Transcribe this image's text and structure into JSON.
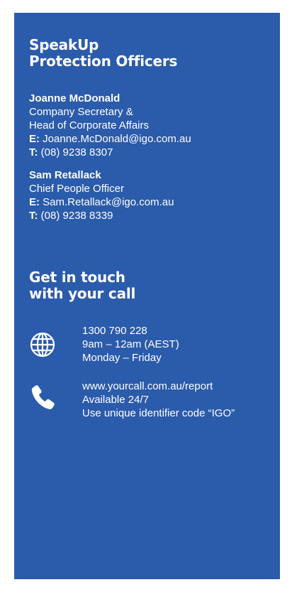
{
  "officers_section": {
    "heading_line1": "SpeakUp",
    "heading_line2": "Protection Officers",
    "officers": [
      {
        "name": "Joanne McDonald",
        "title_line1": "Company Secretary &",
        "title_line2": "Head of Corporate Affairs",
        "email_label": "E:",
        "email": "Joanne.McDonald@igo.com.au",
        "phone_label": "T:",
        "phone": "(08) 9238 8307"
      },
      {
        "name": "Sam Retallack",
        "title_line1": "Chief People Officer",
        "email_label": "E:",
        "email": "Sam.Retallack@igo.com.au",
        "phone_label": "T:",
        "phone": "(08) 9238 8339"
      }
    ]
  },
  "contact_section": {
    "heading_line1": "Get in touch",
    "heading_line2": "with your call",
    "rows": [
      {
        "icon": "globe-icon",
        "line1": "1300 790 228",
        "line2": "9am – 12am (AEST)",
        "line3": "Monday – Friday"
      },
      {
        "icon": "phone-icon",
        "line1": "www.yourcall.com.au/report",
        "line2": "Available 24/7",
        "line3": "Use unique identifier code “IGO”"
      }
    ]
  },
  "colors": {
    "panel_background": "#2b5bab",
    "text": "#ffffff"
  }
}
